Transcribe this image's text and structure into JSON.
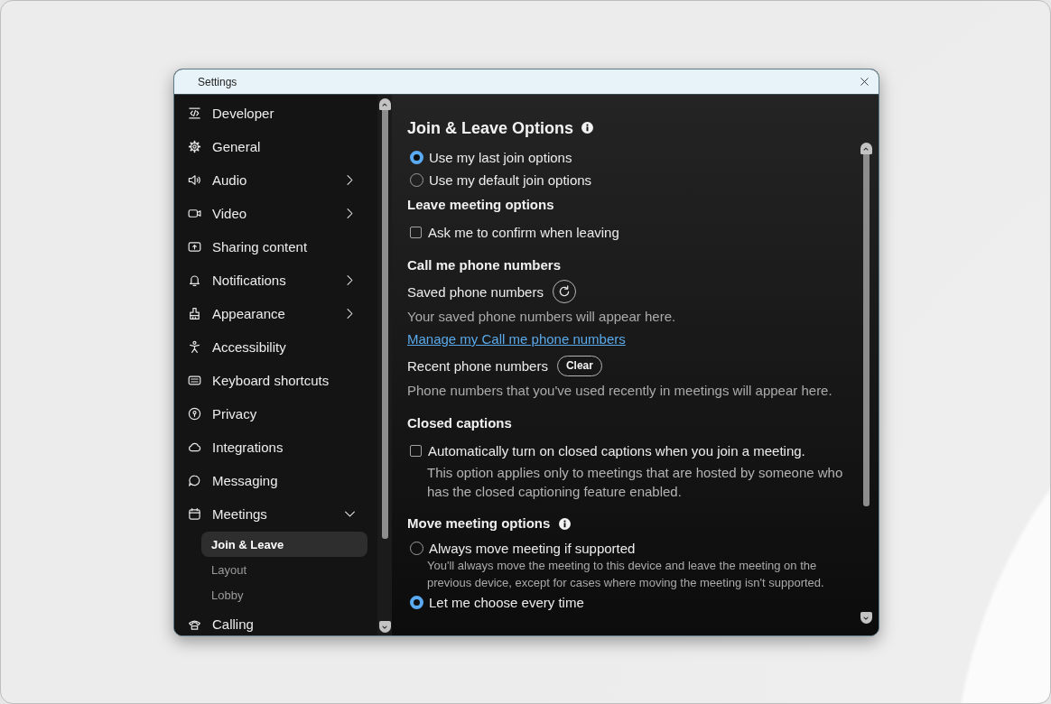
{
  "window": {
    "title": "Settings"
  },
  "sidebar": {
    "items": [
      {
        "label": "Developer",
        "kind": "page",
        "selected": false
      },
      {
        "label": "General",
        "kind": "page",
        "selected": false
      },
      {
        "label": "Audio",
        "kind": "group",
        "expanded": false,
        "selected": false
      },
      {
        "label": "Video",
        "kind": "group",
        "expanded": false,
        "selected": false
      },
      {
        "label": "Sharing content",
        "kind": "page",
        "selected": false
      },
      {
        "label": "Notifications",
        "kind": "group",
        "expanded": false,
        "selected": false
      },
      {
        "label": "Appearance",
        "kind": "group",
        "expanded": false,
        "selected": false
      },
      {
        "label": "Accessibility",
        "kind": "page",
        "selected": false
      },
      {
        "label": "Keyboard shortcuts",
        "kind": "page",
        "selected": false
      },
      {
        "label": "Privacy",
        "kind": "page",
        "selected": false
      },
      {
        "label": "Integrations",
        "kind": "page",
        "selected": false
      },
      {
        "label": "Messaging",
        "kind": "page",
        "selected": false
      },
      {
        "label": "Meetings",
        "kind": "group",
        "expanded": true,
        "selected": false,
        "children": [
          {
            "label": "Join & Leave",
            "selected": true
          },
          {
            "label": "Layout",
            "selected": false
          },
          {
            "label": "Lobby",
            "selected": false
          }
        ]
      },
      {
        "label": "Calling",
        "kind": "page",
        "selected": false
      }
    ]
  },
  "content": {
    "title": "Join & Leave Options",
    "info": true,
    "blocks": [
      {
        "kind": "radios",
        "options": [
          {
            "label": "Use my last join options",
            "selected": true
          },
          {
            "label": "Use my default join options",
            "selected": false
          }
        ]
      },
      {
        "kind": "heading",
        "text": "Leave meeting options"
      },
      {
        "kind": "checkbox",
        "label": "Ask me to confirm when leaving",
        "checked": false
      },
      {
        "kind": "heading",
        "text": "Call me phone numbers"
      },
      {
        "kind": "label",
        "text": "Saved phone numbers",
        "refresh_button": true
      },
      {
        "kind": "hint",
        "text": "Your saved phone numbers will appear here."
      },
      {
        "kind": "link",
        "text": "Manage my Call me phone numbers"
      },
      {
        "kind": "label",
        "text": "Recent phone numbers",
        "button": "Clear"
      },
      {
        "kind": "hint",
        "text": "Phone numbers that you've used recently in meetings will appear here."
      },
      {
        "kind": "heading",
        "text": "Closed captions"
      },
      {
        "kind": "checkbox",
        "label": "Automatically turn on closed captions when you join a meeting.",
        "checked": false,
        "note": "This option applies only to meetings that are hosted by someone who has the closed captioning feature enabled."
      },
      {
        "kind": "heading",
        "text": "Move meeting options",
        "info": true
      },
      {
        "kind": "radios",
        "options": [
          {
            "label": "Always move meeting if supported",
            "selected": false,
            "description": "You'll always move the meeting to this device and leave the meeting on the previous device, except for cases where moving the meeting isn't supported."
          },
          {
            "label": "Let me choose every time",
            "selected": true
          }
        ]
      }
    ]
  }
}
